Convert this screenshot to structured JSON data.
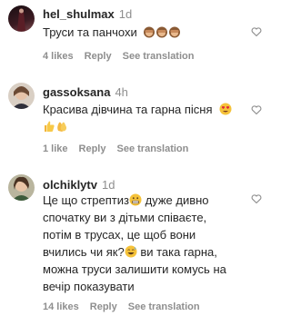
{
  "comments": [
    {
      "username": "hel_shulmax",
      "time": "1d",
      "text": "Труси та панчохи",
      "likes": "4 likes",
      "reply": "Reply",
      "translate": "See translation"
    },
    {
      "username": "gassoksana",
      "time": "4h",
      "text_line1": "Красива дівчина та гарна пісня",
      "likes": "1 like",
      "reply": "Reply",
      "translate": "See translation"
    },
    {
      "username": "olchiklytv",
      "time": "1d",
      "lines": [
        "Це що стрептиз",
        " дуже дивно",
        "спочатку ви з дітьми співаєте,",
        "потім в трусах, це щоб вони",
        "вчились чи як?",
        " ви така гарна,",
        "можна труси залишити комусь на",
        "вечір показувати"
      ],
      "likes": "14 likes",
      "reply": "Reply",
      "translate": "See translation"
    }
  ],
  "icons": {
    "heart": "heart-outline-icon",
    "monkey": "see-no-evil-monkey-emoji",
    "heart_eyes": "heart-eyes-emoji",
    "thumbs_up": "thumbs-up-emoji",
    "clap": "clapping-hands-emoji",
    "grimace": "grimacing-face-emoji",
    "grin": "grinning-sweat-emoji"
  }
}
